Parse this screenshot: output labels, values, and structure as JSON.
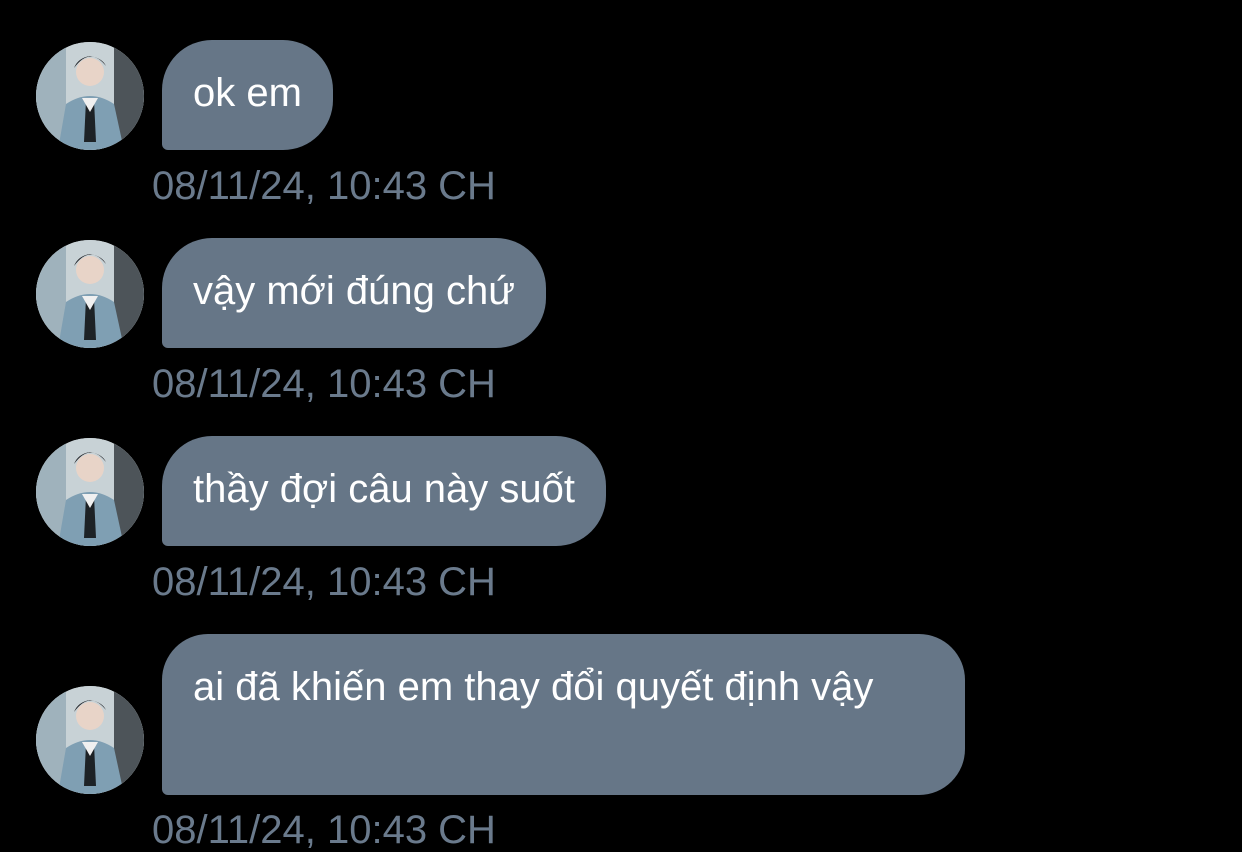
{
  "messages": [
    {
      "text": "ok em",
      "timestamp": "08/11/24, 10:43 CH"
    },
    {
      "text": "vậy mới đúng chứ",
      "timestamp": "08/11/24, 10:43 CH"
    },
    {
      "text": "thầy đợi câu này suốt",
      "timestamp": "08/11/24, 10:43 CH"
    },
    {
      "text": "ai đã khiến em thay đổi quyết định vậy",
      "timestamp": "08/11/24, 10:43 CH"
    }
  ],
  "colors": {
    "background": "#000000",
    "bubble": "#667687",
    "bubble_text": "#ffffff",
    "timestamp": "#6a7a8c"
  },
  "icons": {
    "avatar": "contact-avatar-photo"
  }
}
